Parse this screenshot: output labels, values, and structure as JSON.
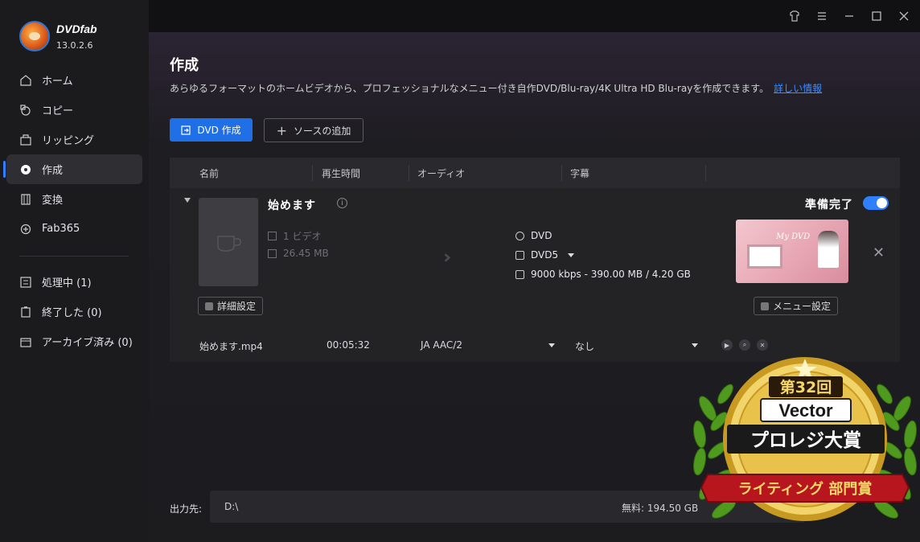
{
  "app": {
    "name": "DVDfab",
    "version": "13.0.2.6"
  },
  "sidebar": {
    "items": [
      {
        "label": "ホーム",
        "icon": "home-icon"
      },
      {
        "label": "コピー",
        "icon": "copy-icon"
      },
      {
        "label": "リッピング",
        "icon": "ripping-icon"
      },
      {
        "label": "作成",
        "icon": "disc-icon",
        "active": true
      },
      {
        "label": "変換",
        "icon": "film-icon"
      },
      {
        "label": "Fab365",
        "icon": "fab365-icon"
      }
    ],
    "status_items": [
      {
        "label": "処理中 (1)",
        "icon": "processing-icon"
      },
      {
        "label": "終了した (0)",
        "icon": "finished-icon"
      },
      {
        "label": "アーカイブ済み (0)",
        "icon": "archive-icon"
      }
    ]
  },
  "window_controls": [
    "skin-icon",
    "menu-icon",
    "minimize-icon",
    "maximize-icon",
    "close-icon"
  ],
  "main": {
    "title": "作成",
    "description": "あらゆるフォーマットのホームビデオから、プロフェッショナルなメニュー付き自作DVD/Blu-ray/4K Ultra HD Blu-rayを作成できます。",
    "more_info_link": "詳しい情報",
    "primary_button": "DVD 作成",
    "add_source_button": "ソースの追加"
  },
  "table": {
    "headers": [
      "名前",
      "再生時間",
      "オーディオ",
      "字幕"
    ],
    "item": {
      "title": "始めます",
      "video_count": "1 ビデオ",
      "size": "26.45 MB",
      "output_format": "DVD",
      "disc_type": "DVD5",
      "bitrate_info": "9000 kbps - 390.00 MB / 4.20 GB",
      "ready_label": "準備完了",
      "ready_enabled": true,
      "detail_settings_button": "詳細設定",
      "menu_settings_button": "メニュー設定",
      "menu_thumbnail_title": "My DVD"
    },
    "file_row": {
      "filename": "始めます.mp4",
      "duration": "00:05:32",
      "audio": "JA  AAC/2",
      "subtitle": "なし"
    }
  },
  "footer": {
    "output_label": "出力先:",
    "output_path": "D:\\",
    "free_space": "無料:   194.50 GB"
  },
  "award": {
    "line1": "第32回",
    "line2": "Vector",
    "line3": "プロレジ大賞",
    "line4": "ライティング 部門賞"
  },
  "colors": {
    "accent": "#1f6fe6",
    "toggle": "#2f80ff",
    "link": "#3d8bff",
    "award_gold": "#e2b83a",
    "award_red": "#b8161e",
    "laurel_green": "#4f9a1e"
  }
}
